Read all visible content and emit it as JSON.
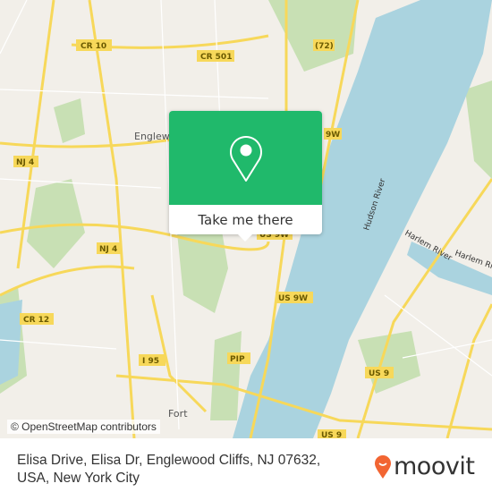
{
  "map": {
    "colors": {
      "land": "#f2efe9",
      "water": "#aad3df",
      "park": "#c8e0b4",
      "road": "#f7d85a",
      "accent": "#20b96b",
      "brand": "#f26532"
    },
    "road_labels": [
      "CR 10",
      "CR 501",
      "(72)",
      "9W",
      "NJ 4",
      "NJ 4",
      "US 9W",
      "US 9W",
      "CR 12",
      "I 95",
      "PIP",
      "US 9",
      "US 9"
    ],
    "place_labels": [
      "Englewood",
      "Fort"
    ],
    "water_labels": [
      "Hudson River",
      "Harlem River",
      "Harlem Riv"
    ],
    "attribution": "© OpenStreetMap contributors"
  },
  "popup": {
    "icon": "map-pin-icon",
    "button_label": "Take me there"
  },
  "footer": {
    "address": "Elisa Drive, Elisa Dr, Englewood Cliffs, NJ 07632, USA, New York City",
    "logo_text": "moovit"
  }
}
